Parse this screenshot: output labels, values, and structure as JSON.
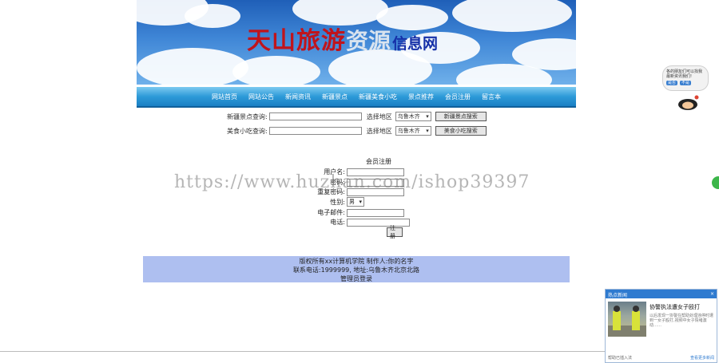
{
  "banner": {
    "title_red": "天山旅游",
    "title_white": "资源",
    "title_blue": "信息网"
  },
  "nav": {
    "items": [
      "网站首页",
      "网站公告",
      "新闻资讯",
      "新疆景点",
      "新疆美食小吃",
      "景点推荐",
      "会员注册",
      "留言本"
    ]
  },
  "search": {
    "scenic_label": "新疆景点查询:",
    "scenic_region_label": "选择地区",
    "scenic_region_value": "乌鲁木齐",
    "scenic_button": "新疆景点搜索",
    "food_label": "美食小吃查询:",
    "food_region_label": "选择地区",
    "food_region_value": "乌鲁木齐",
    "food_button": "美食小吃搜索"
  },
  "register": {
    "title": "会员注册",
    "username_label": "用户名:",
    "password_label": "密码:",
    "confirm_label": "重复密码:",
    "gender_label": "性别:",
    "gender_value": "男",
    "email_label": "电子邮件:",
    "phone_label": "电话:",
    "submit_label": "注册"
  },
  "footer": {
    "line1": "版权所有xx计算机学院 制作人:你的名字",
    "line2": "联系电话:1999999, 地址:乌鲁木齐北京北路",
    "admin_link": "管理员登录"
  },
  "watermark": "https://www.huzhan.com/ishop39397",
  "chat": {
    "text1": "各的朋友们可以找我",
    "text2": "最新资讯我们!",
    "btn1": "是否",
    "btn2": "不是"
  },
  "news_popup": {
    "header": "热点新闻",
    "close": "×",
    "title": "协警执法遭女子殴打",
    "desc": "以后发现一协警在帮助处理违停时遭到一女子殴打,视频中女子情绪激动……",
    "footer_left": "帮助已插入法",
    "footer_right": "查看更多新闻"
  },
  "colors": {
    "nav_blue": "#2d9ad8",
    "footer_bg": "#aebff0",
    "title_red": "#c0141c",
    "title_blue": "#1530a8"
  }
}
